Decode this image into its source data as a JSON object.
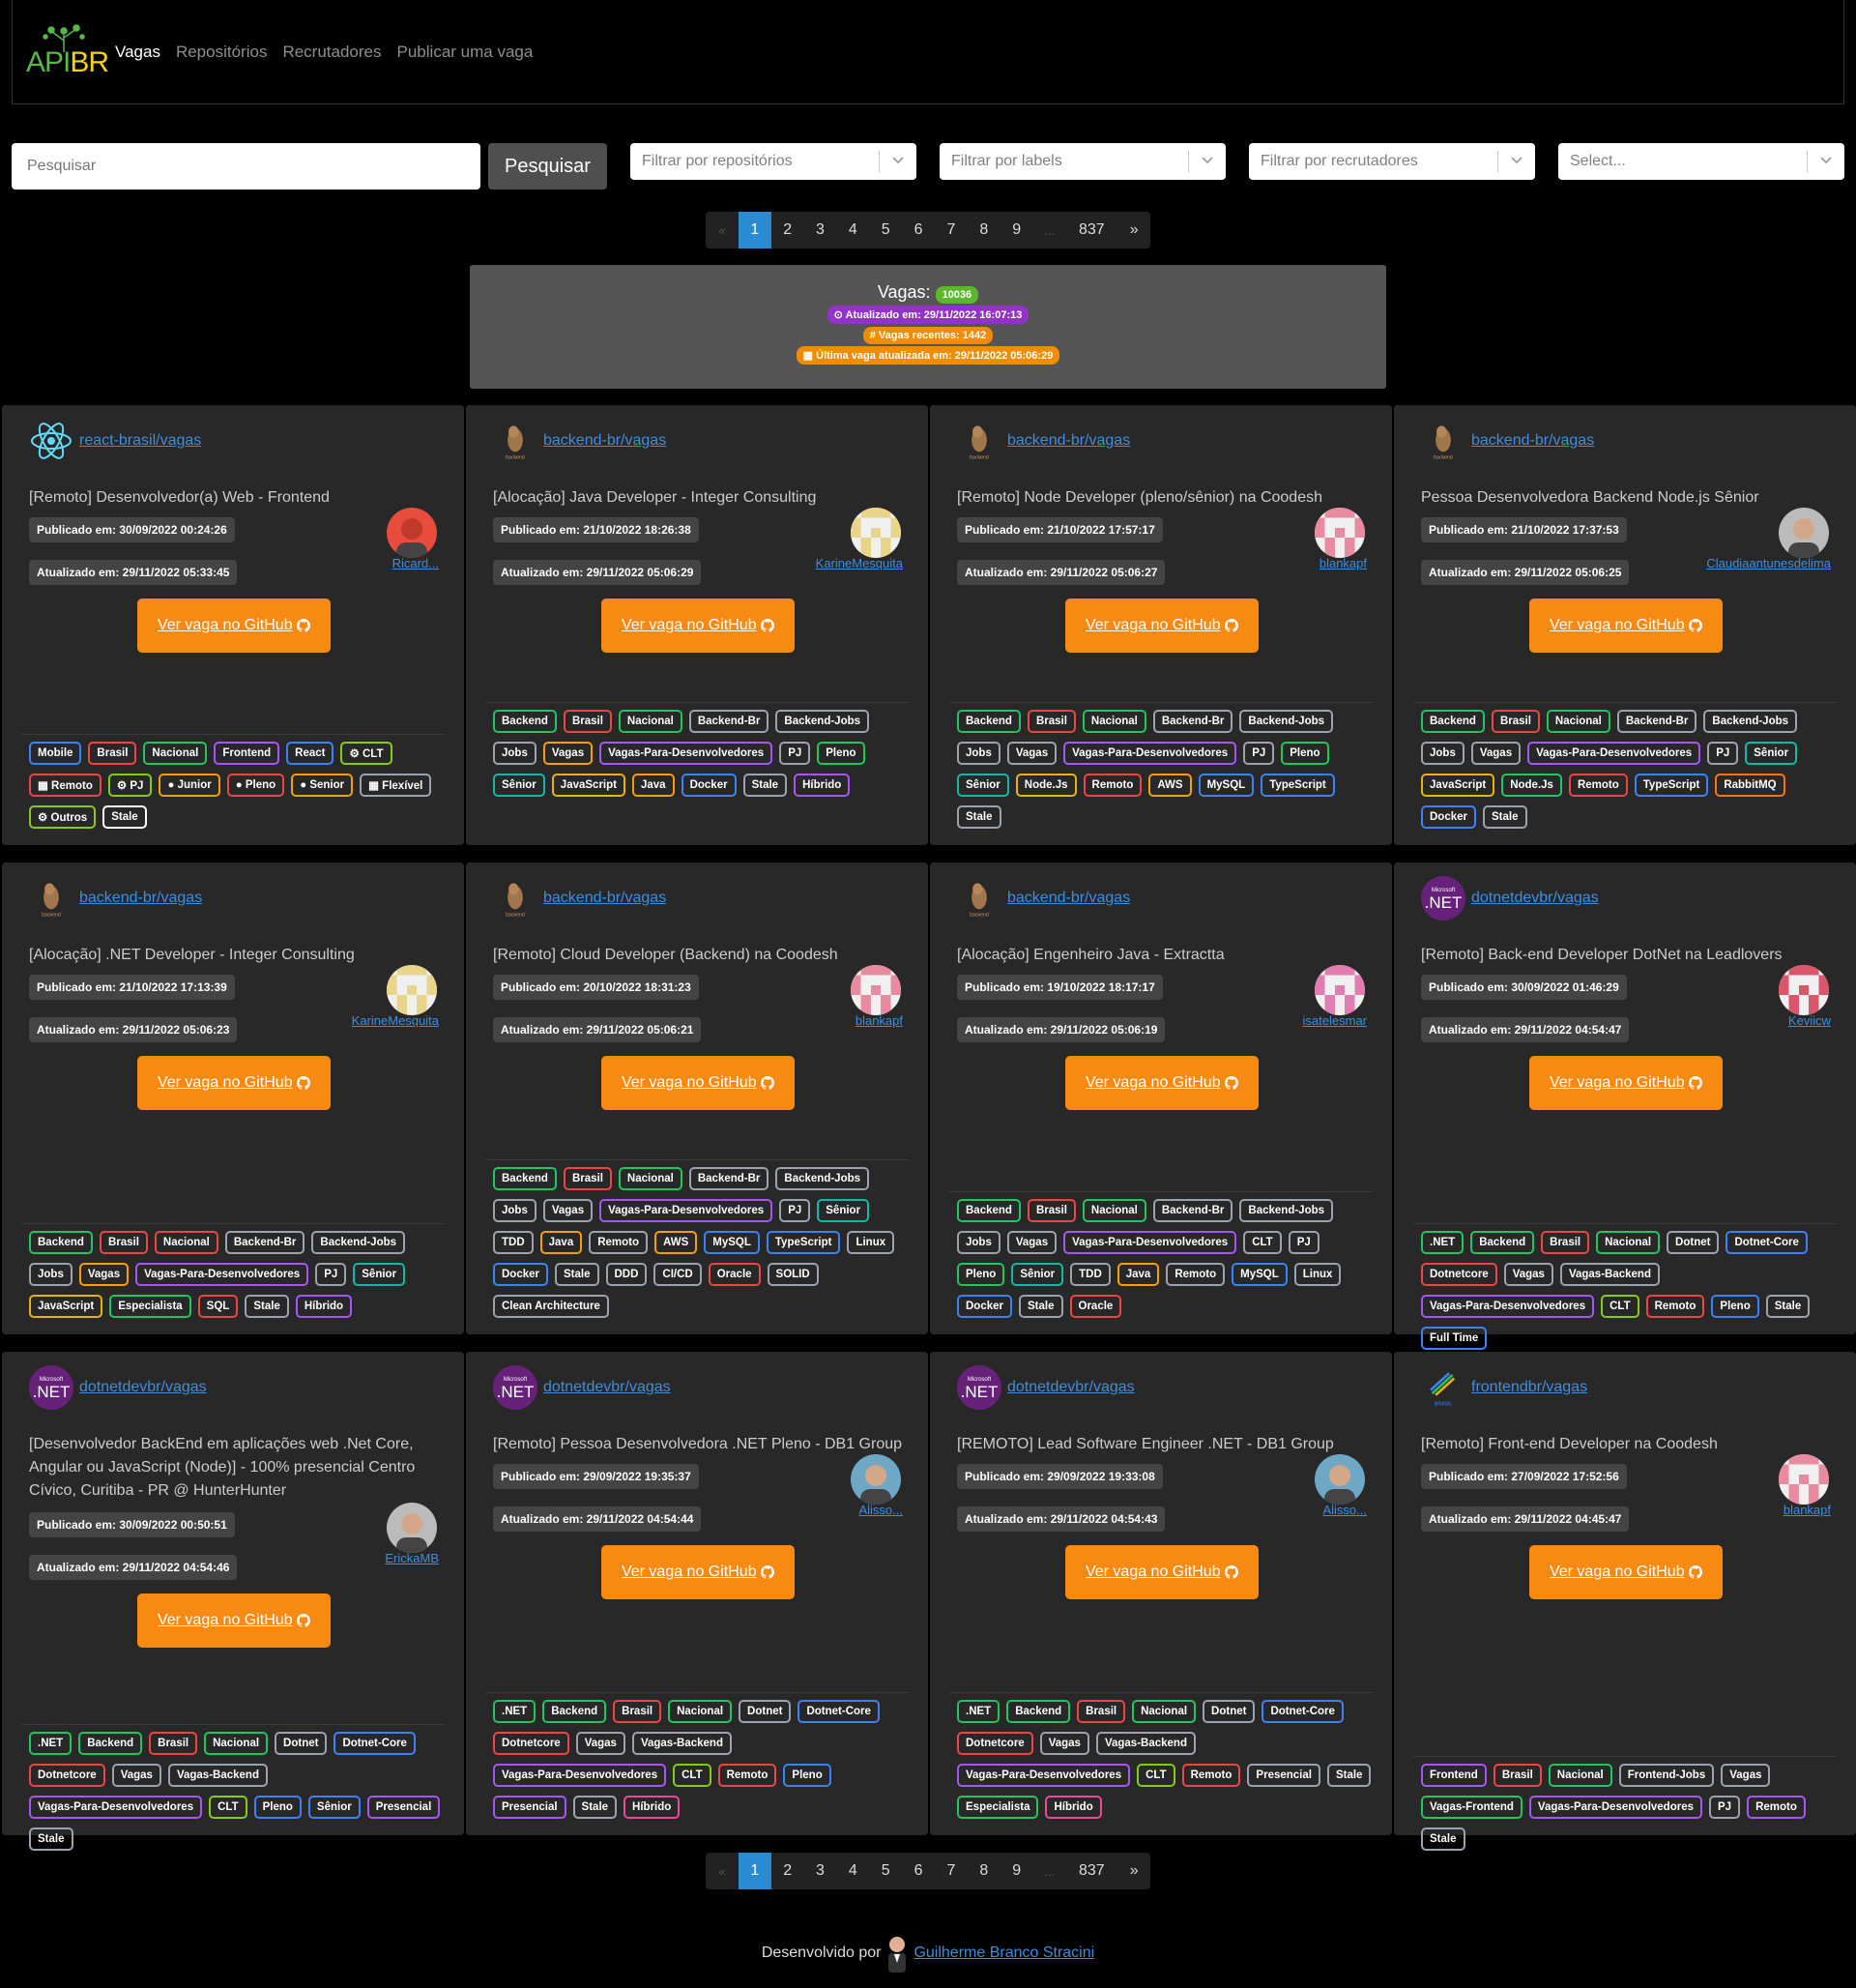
{
  "nav": {
    "logo_api": "API",
    "logo_br": "BR",
    "links": [
      "Vagas",
      "Repositórios",
      "Recrutadores",
      "Publicar uma vaga"
    ]
  },
  "search": {
    "placeholder": "Pesquisar",
    "button": "Pesquisar"
  },
  "filters": [
    "Filtrar por repositórios",
    "Filtrar por labels",
    "Filtrar por recrutadores",
    "Select..."
  ],
  "pagination": {
    "prev": "«",
    "pages": [
      "1",
      "2",
      "3",
      "4",
      "5",
      "6",
      "7",
      "8",
      "9"
    ],
    "ellipsis": "...",
    "last": "837",
    "next": "»"
  },
  "stats": {
    "label": "Vagas:",
    "count": "10036",
    "updated": "⊙ Atualizado em: 29/11/2022 16:07:13",
    "recent": "# Vagas recentes: 1442",
    "last_job": "▦ Última vaga atualizada em: 29/11/2022 05:06:29"
  },
  "colors": {
    "accent": "#f68a12",
    "active_page": "#2a8bd2",
    "card_bg": "#282828"
  },
  "cards": [
    {
      "repo": "react-brasil/vagas",
      "logo": "react-icon",
      "title": "[Remoto] Desenvolvedor(a) Web - Frontend",
      "published": "Publicado em: 30/09/2022 00:24:26",
      "updated": "Atualizado em: 29/11/2022 05:33:45",
      "user": "Ricard...",
      "avatar": "photo-avatar-red",
      "button": "Ver vaga no GitHub",
      "tags": [
        [
          "Mobile",
          "#3b82f6"
        ],
        [
          "Brasil",
          "#ef4444"
        ],
        [
          "Nacional",
          "#22c55e"
        ],
        [
          "Frontend",
          "#a855f7"
        ],
        [
          "React",
          "#3b82f6"
        ],
        [
          "⚙ CLT",
          "#84cc16"
        ],
        [
          "▦ Remoto",
          "#ef4444"
        ],
        [
          "⚙ PJ",
          "#84cc16"
        ],
        [
          "● Junior",
          "#f59e0b"
        ],
        [
          "● Pleno",
          "#ef4444"
        ],
        [
          "● Senior",
          "#f59e0b"
        ],
        [
          "▦ Flexível",
          "#9ca3af"
        ],
        [
          "⚙ Outros",
          "#84cc16"
        ],
        [
          "Stale",
          "#ffffff"
        ]
      ]
    },
    {
      "repo": "backend-br/vagas",
      "logo": "capybara-icon",
      "title": "[Alocação] Java Developer - Integer Consulting",
      "published": "Publicado em: 21/10/2022 18:26:38",
      "updated": "Atualizado em: 29/11/2022 05:06:29",
      "user": "KarineMesquita",
      "avatar": "identicon-yellow",
      "button": "Ver vaga no GitHub",
      "tags": [
        [
          "Backend",
          "#22c55e"
        ],
        [
          "Brasil",
          "#ef4444"
        ],
        [
          "Nacional",
          "#22c55e"
        ],
        [
          "Backend-Br",
          "#9ca3af"
        ],
        [
          "Backend-Jobs",
          "#9ca3af"
        ],
        [
          "Jobs",
          "#9ca3af"
        ],
        [
          "Vagas",
          "#f59e0b"
        ],
        [
          "Vagas-Para-Desenvolvedores",
          "#a855f7"
        ],
        [
          "PJ",
          "#9ca3af"
        ],
        [
          "Pleno",
          "#22c55e"
        ],
        [
          "Sênior",
          "#14b8a6"
        ],
        [
          "JavaScript",
          "#eab308"
        ],
        [
          "Java",
          "#f59e0b"
        ],
        [
          "Docker",
          "#3b82f6"
        ],
        [
          "Stale",
          "#9ca3af"
        ],
        [
          "Híbrido",
          "#a855f7"
        ]
      ]
    },
    {
      "repo": "backend-br/vagas",
      "logo": "capybara-icon",
      "title": "[Remoto] Node Developer (pleno/sênior) na Coodesh",
      "published": "Publicado em: 21/10/2022 17:57:17",
      "updated": "Atualizado em: 29/11/2022 05:06:27",
      "user": "blankapf",
      "avatar": "identicon-pink",
      "button": "Ver vaga no GitHub",
      "tags": [
        [
          "Backend",
          "#22c55e"
        ],
        [
          "Brasil",
          "#ef4444"
        ],
        [
          "Nacional",
          "#22c55e"
        ],
        [
          "Backend-Br",
          "#9ca3af"
        ],
        [
          "Backend-Jobs",
          "#9ca3af"
        ],
        [
          "Jobs",
          "#9ca3af"
        ],
        [
          "Vagas",
          "#9ca3af"
        ],
        [
          "Vagas-Para-Desenvolvedores",
          "#a855f7"
        ],
        [
          "PJ",
          "#9ca3af"
        ],
        [
          "Pleno",
          "#22c55e"
        ],
        [
          "Sênior",
          "#14b8a6"
        ],
        [
          "Node.Js",
          "#eab308"
        ],
        [
          "Remoto",
          "#ef4444"
        ],
        [
          "AWS",
          "#f59e0b"
        ],
        [
          "MySQL",
          "#3b82f6"
        ],
        [
          "TypeScript",
          "#3b82f6"
        ],
        [
          "Stale",
          "#9ca3af"
        ]
      ]
    },
    {
      "repo": "backend-br/vagas",
      "logo": "capybara-icon",
      "title": "Pessoa Desenvolvedora Backend Node.js Sênior",
      "published": "Publicado em: 21/10/2022 17:37:53",
      "updated": "Atualizado em: 29/11/2022 05:06:25",
      "user": "Claudiaantunesdelima",
      "avatar": "photo-avatar-woman",
      "button": "Ver vaga no GitHub",
      "tags": [
        [
          "Backend",
          "#22c55e"
        ],
        [
          "Brasil",
          "#ef4444"
        ],
        [
          "Nacional",
          "#22c55e"
        ],
        [
          "Backend-Br",
          "#9ca3af"
        ],
        [
          "Backend-Jobs",
          "#9ca3af"
        ],
        [
          "Jobs",
          "#9ca3af"
        ],
        [
          "Vagas",
          "#9ca3af"
        ],
        [
          "Vagas-Para-Desenvolvedores",
          "#a855f7"
        ],
        [
          "PJ",
          "#9ca3af"
        ],
        [
          "Sênior",
          "#14b8a6"
        ],
        [
          "JavaScript",
          "#eab308"
        ],
        [
          "Node.Js",
          "#22c55e"
        ],
        [
          "Remoto",
          "#ef4444"
        ],
        [
          "TypeScript",
          "#3b82f6"
        ],
        [
          "RabbitMQ",
          "#f97316"
        ],
        [
          "Docker",
          "#3b82f6"
        ],
        [
          "Stale",
          "#9ca3af"
        ]
      ]
    },
    {
      "repo": "backend-br/vagas",
      "logo": "capybara-icon",
      "title": "[Alocação] .NET Developer - Integer Consulting",
      "published": "Publicado em: 21/10/2022 17:13:39",
      "updated": "Atualizado em: 29/11/2022 05:06:23",
      "user": "KarineMesquita",
      "avatar": "identicon-yellow",
      "button": "Ver vaga no GitHub",
      "tags": [
        [
          "Backend",
          "#22c55e"
        ],
        [
          "Brasil",
          "#ef4444"
        ],
        [
          "Nacional",
          "#ef4444"
        ],
        [
          "Backend-Br",
          "#9ca3af"
        ],
        [
          "Backend-Jobs",
          "#9ca3af"
        ],
        [
          "Jobs",
          "#9ca3af"
        ],
        [
          "Vagas",
          "#f59e0b"
        ],
        [
          "Vagas-Para-Desenvolvedores",
          "#a855f7"
        ],
        [
          "PJ",
          "#9ca3af"
        ],
        [
          "Sênior",
          "#14b8a6"
        ],
        [
          "JavaScript",
          "#eab308"
        ],
        [
          "Especialista",
          "#22c55e"
        ],
        [
          "SQL",
          "#ef4444"
        ],
        [
          "Stale",
          "#9ca3af"
        ],
        [
          "Híbrido",
          "#a855f7"
        ]
      ]
    },
    {
      "repo": "backend-br/vagas",
      "logo": "capybara-icon",
      "title": "[Remoto] Cloud Developer (Backend) na Coodesh",
      "published": "Publicado em: 20/10/2022 18:31:23",
      "updated": "Atualizado em: 29/11/2022 05:06:21",
      "user": "blankapf",
      "avatar": "identicon-pink",
      "button": "Ver vaga no GitHub",
      "tags": [
        [
          "Backend",
          "#22c55e"
        ],
        [
          "Brasil",
          "#ef4444"
        ],
        [
          "Nacional",
          "#22c55e"
        ],
        [
          "Backend-Br",
          "#9ca3af"
        ],
        [
          "Backend-Jobs",
          "#9ca3af"
        ],
        [
          "Jobs",
          "#9ca3af"
        ],
        [
          "Vagas",
          "#9ca3af"
        ],
        [
          "Vagas-Para-Desenvolvedores",
          "#a855f7"
        ],
        [
          "PJ",
          "#9ca3af"
        ],
        [
          "Sênior",
          "#14b8a6"
        ],
        [
          "TDD",
          "#9ca3af"
        ],
        [
          "Java",
          "#f59e0b"
        ],
        [
          "Remoto",
          "#9ca3af"
        ],
        [
          "AWS",
          "#f59e0b"
        ],
        [
          "MySQL",
          "#3b82f6"
        ],
        [
          "TypeScript",
          "#3b82f6"
        ],
        [
          "Linux",
          "#9ca3af"
        ],
        [
          "Docker",
          "#3b82f6"
        ],
        [
          "Stale",
          "#9ca3af"
        ],
        [
          "DDD",
          "#9ca3af"
        ],
        [
          "CI/CD",
          "#9ca3af"
        ],
        [
          "Oracle",
          "#ef4444"
        ],
        [
          "SOLID",
          "#9ca3af"
        ],
        [
          "Clean Architecture",
          "#9ca3af"
        ]
      ]
    },
    {
      "repo": "backend-br/vagas",
      "logo": "capybara-icon",
      "title": "[Alocação] Engenheiro Java - Extractta",
      "published": "Publicado em: 19/10/2022 18:17:17",
      "updated": "Atualizado em: 29/11/2022 05:06:19",
      "user": "isatelesmar",
      "avatar": "identicon-pink2",
      "button": "Ver vaga no GitHub",
      "tags": [
        [
          "Backend",
          "#22c55e"
        ],
        [
          "Brasil",
          "#ef4444"
        ],
        [
          "Nacional",
          "#22c55e"
        ],
        [
          "Backend-Br",
          "#9ca3af"
        ],
        [
          "Backend-Jobs",
          "#9ca3af"
        ],
        [
          "Jobs",
          "#9ca3af"
        ],
        [
          "Vagas",
          "#9ca3af"
        ],
        [
          "Vagas-Para-Desenvolvedores",
          "#a855f7"
        ],
        [
          "CLT",
          "#9ca3af"
        ],
        [
          "PJ",
          "#9ca3af"
        ],
        [
          "Pleno",
          "#22c55e"
        ],
        [
          "Sênior",
          "#14b8a6"
        ],
        [
          "TDD",
          "#9ca3af"
        ],
        [
          "Java",
          "#f59e0b"
        ],
        [
          "Remoto",
          "#9ca3af"
        ],
        [
          "MySQL",
          "#3b82f6"
        ],
        [
          "Linux",
          "#9ca3af"
        ],
        [
          "Docker",
          "#3b82f6"
        ],
        [
          "Stale",
          "#9ca3af"
        ],
        [
          "Oracle",
          "#ef4444"
        ]
      ]
    },
    {
      "repo": "dotnetdevbr/vagas",
      "logo": "dotnet-icon",
      "title": "[Remoto] Back-end Developer DotNet na Leadlovers",
      "published": "Publicado em: 30/09/2022 01:46:29",
      "updated": "Atualizado em: 29/11/2022 04:54:47",
      "user": "Keviicw",
      "avatar": "identicon-red",
      "button": "Ver vaga no GitHub",
      "tags": [
        [
          ".NET",
          "#22c55e"
        ],
        [
          "Backend",
          "#22c55e"
        ],
        [
          "Brasil",
          "#ef4444"
        ],
        [
          "Nacional",
          "#22c55e"
        ],
        [
          "Dotnet",
          "#9ca3af"
        ],
        [
          "Dotnet-Core",
          "#3b82f6"
        ],
        [
          "Dotnetcore",
          "#ef4444"
        ],
        [
          "Vagas",
          "#9ca3af"
        ],
        [
          "Vagas-Backend",
          "#9ca3af"
        ],
        [
          "Vagas-Para-Desenvolvedores",
          "#a855f7"
        ],
        [
          "CLT",
          "#84cc16"
        ],
        [
          "Remoto",
          "#ef4444"
        ],
        [
          "Pleno",
          "#3b82f6"
        ],
        [
          "Stale",
          "#9ca3af"
        ],
        [
          "Full Time",
          "#3b82f6"
        ]
      ]
    },
    {
      "repo": "dotnetdevbr/vagas",
      "logo": "dotnet-icon",
      "title": "[Desenvolvedor BackEnd em aplicações web .Net Core, Angular ou JavaScript (Node)] - 100% presencial Centro Cívico, Curitiba - PR @ HunterHunter",
      "published": "Publicado em: 30/09/2022 00:50:51",
      "updated": "Atualizado em: 29/11/2022 04:54:46",
      "user": "ErickaMB",
      "avatar": "photo-avatar-woman2",
      "button": "Ver vaga no GitHub",
      "tags": [
        [
          ".NET",
          "#22c55e"
        ],
        [
          "Backend",
          "#22c55e"
        ],
        [
          "Brasil",
          "#ef4444"
        ],
        [
          "Nacional",
          "#22c55e"
        ],
        [
          "Dotnet",
          "#9ca3af"
        ],
        [
          "Dotnet-Core",
          "#3b82f6"
        ],
        [
          "Dotnetcore",
          "#ef4444"
        ],
        [
          "Vagas",
          "#9ca3af"
        ],
        [
          "Vagas-Backend",
          "#9ca3af"
        ],
        [
          "Vagas-Para-Desenvolvedores",
          "#a855f7"
        ],
        [
          "CLT",
          "#84cc16"
        ],
        [
          "Pleno",
          "#3b82f6"
        ],
        [
          "Sênior",
          "#3b82f6"
        ],
        [
          "Presencial",
          "#a855f7"
        ],
        [
          "Stale",
          "#9ca3af"
        ]
      ]
    },
    {
      "repo": "dotnetdevbr/vagas",
      "logo": "dotnet-icon",
      "title": "[Remoto] Pessoa Desenvolvedora .NET Pleno - DB1 Group",
      "published": "Publicado em: 29/09/2022 19:35:37",
      "updated": "Atualizado em: 29/11/2022 04:54:44",
      "user": "Alisso...",
      "avatar": "photo-avatar-man",
      "button": "Ver vaga no GitHub",
      "tags": [
        [
          ".NET",
          "#22c55e"
        ],
        [
          "Backend",
          "#22c55e"
        ],
        [
          "Brasil",
          "#ef4444"
        ],
        [
          "Nacional",
          "#22c55e"
        ],
        [
          "Dotnet",
          "#9ca3af"
        ],
        [
          "Dotnet-Core",
          "#3b82f6"
        ],
        [
          "Dotnetcore",
          "#ef4444"
        ],
        [
          "Vagas",
          "#9ca3af"
        ],
        [
          "Vagas-Backend",
          "#9ca3af"
        ],
        [
          "Vagas-Para-Desenvolvedores",
          "#a855f7"
        ],
        [
          "CLT",
          "#84cc16"
        ],
        [
          "Remoto",
          "#ef4444"
        ],
        [
          "Pleno",
          "#3b82f6"
        ],
        [
          "Presencial",
          "#a855f7"
        ],
        [
          "Stale",
          "#9ca3af"
        ],
        [
          "Híbrido",
          "#ec4899"
        ]
      ]
    },
    {
      "repo": "dotnetdevbr/vagas",
      "logo": "dotnet-icon",
      "title": "[REMOTO] Lead Software Engineer .NET - DB1 Group",
      "published": "Publicado em: 29/09/2022 19:33:08",
      "updated": "Atualizado em: 29/11/2022 04:54:43",
      "user": "Alisso...",
      "avatar": "photo-avatar-man",
      "button": "Ver vaga no GitHub",
      "tags": [
        [
          ".NET",
          "#22c55e"
        ],
        [
          "Backend",
          "#22c55e"
        ],
        [
          "Brasil",
          "#ef4444"
        ],
        [
          "Nacional",
          "#22c55e"
        ],
        [
          "Dotnet",
          "#9ca3af"
        ],
        [
          "Dotnet-Core",
          "#3b82f6"
        ],
        [
          "Dotnetcore",
          "#ef4444"
        ],
        [
          "Vagas",
          "#9ca3af"
        ],
        [
          "Vagas-Backend",
          "#9ca3af"
        ],
        [
          "Vagas-Para-Desenvolvedores",
          "#a855f7"
        ],
        [
          "CLT",
          "#84cc16"
        ],
        [
          "Remoto",
          "#ef4444"
        ],
        [
          "Presencial",
          "#9ca3af"
        ],
        [
          "Stale",
          "#9ca3af"
        ],
        [
          "Especialista",
          "#22c55e"
        ],
        [
          "Híbrido",
          "#ec4899"
        ]
      ]
    },
    {
      "repo": "frontendbr/vagas",
      "logo": "frontendbr-icon",
      "title": "[Remoto] Front-end Developer na Coodesh",
      "published": "Publicado em: 27/09/2022 17:52:56",
      "updated": "Atualizado em: 29/11/2022 04:45:47",
      "user": "blankapf",
      "avatar": "identicon-pink",
      "button": "Ver vaga no GitHub",
      "tags": [
        [
          "Frontend",
          "#a855f7"
        ],
        [
          "Brasil",
          "#ef4444"
        ],
        [
          "Nacional",
          "#22c55e"
        ],
        [
          "Frontend-Jobs",
          "#9ca3af"
        ],
        [
          "Vagas",
          "#9ca3af"
        ],
        [
          "Vagas-Frontend",
          "#22c55e"
        ],
        [
          "Vagas-Para-Desenvolvedores",
          "#a855f7"
        ],
        [
          "PJ",
          "#9ca3af"
        ],
        [
          "Remoto",
          "#a855f7"
        ],
        [
          "Stale",
          "#9ca3af"
        ]
      ]
    }
  ],
  "footer": {
    "text": "Desenvolvido por",
    "author": "Guilherme Branco Stracini"
  }
}
